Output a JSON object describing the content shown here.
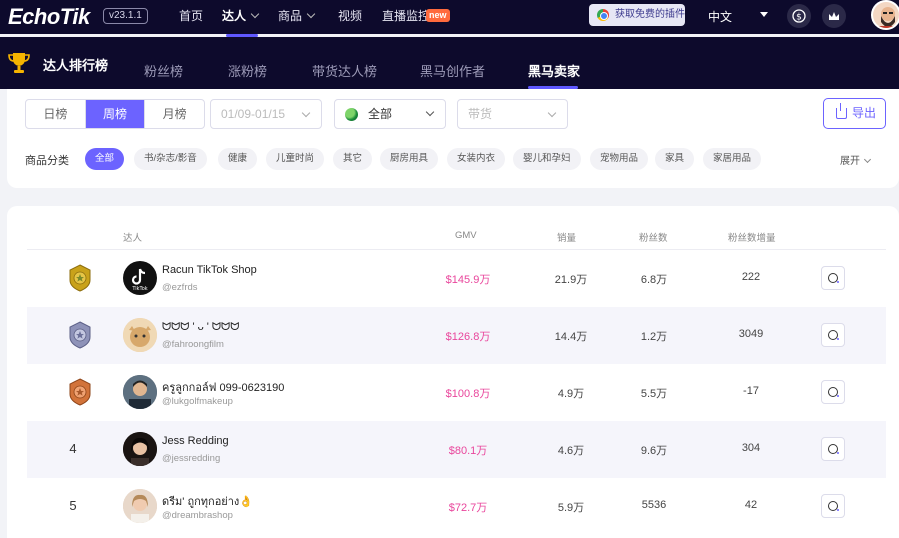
{
  "app": {
    "logo": "EchoTik",
    "version": "v23.1.1"
  },
  "nav": {
    "home": "首页",
    "influencer": "达人",
    "products": "商品",
    "video": "视频",
    "live": "直播监控",
    "live_badge": "new",
    "plugin": "获取免费的插件",
    "language": "中文"
  },
  "subnav": {
    "title": "达人排行榜",
    "tabs": [
      "粉丝榜",
      "涨粉榜",
      "带货达人榜",
      "黑马创作者",
      "黑马卖家"
    ]
  },
  "filters": {
    "period": [
      "日榜",
      "周榜",
      "月榜"
    ],
    "date_range": "01/09-01/15",
    "region": "全部",
    "type_placeholder": "带货",
    "export": "导出",
    "category_label": "商品分类",
    "categories": [
      "全部",
      "书/杂志/影音",
      "健康",
      "儿童时尚",
      "其它",
      "厨房用具",
      "女装内衣",
      "婴儿和孕妇",
      "宠物用品",
      "家具",
      "家居用品"
    ],
    "expand": "展开"
  },
  "table": {
    "headers": {
      "influencer": "达人",
      "gmv": "GMV",
      "sales": "销量",
      "followers": "粉丝数",
      "follower_growth": "粉丝数增量"
    },
    "rows": [
      {
        "rank": "1",
        "name": "Racun TikTok Shop",
        "handle": "@ezfrds",
        "gmv": "$145.9万",
        "sales": "21.9万",
        "followers": "6.8万",
        "growth": "222"
      },
      {
        "rank": "2",
        "name": "ᗢᗢᗢ ' ᴗ ' ᗢᗢᗢ",
        "handle": "@fahroongfilm",
        "gmv": "$126.8万",
        "sales": "14.4万",
        "followers": "1.2万",
        "growth": "3049"
      },
      {
        "rank": "3",
        "name": "ครูลูกกอล์ฟ 099-0623190",
        "handle": "@lukgolfmakeup",
        "gmv": "$100.8万",
        "sales": "4.9万",
        "followers": "5.5万",
        "growth": "-17"
      },
      {
        "rank": "4",
        "name": "Jess Redding",
        "handle": "@jessredding",
        "gmv": "$80.1万",
        "sales": "4.6万",
        "followers": "9.6万",
        "growth": "304"
      },
      {
        "rank": "5",
        "name": "ดรีม' ถูกทุกอย่าง👌",
        "handle": "@dreambrashop",
        "gmv": "$72.7万",
        "sales": "5.9万",
        "followers": "5536",
        "growth": "42"
      }
    ]
  },
  "colors": {
    "nav_bg": "#0d0a2c",
    "accent": "#6c63ff",
    "gmv": "#e9469c",
    "gold": "#c9a21a",
    "silver": "#8e92b8",
    "bronze": "#d2733a"
  }
}
